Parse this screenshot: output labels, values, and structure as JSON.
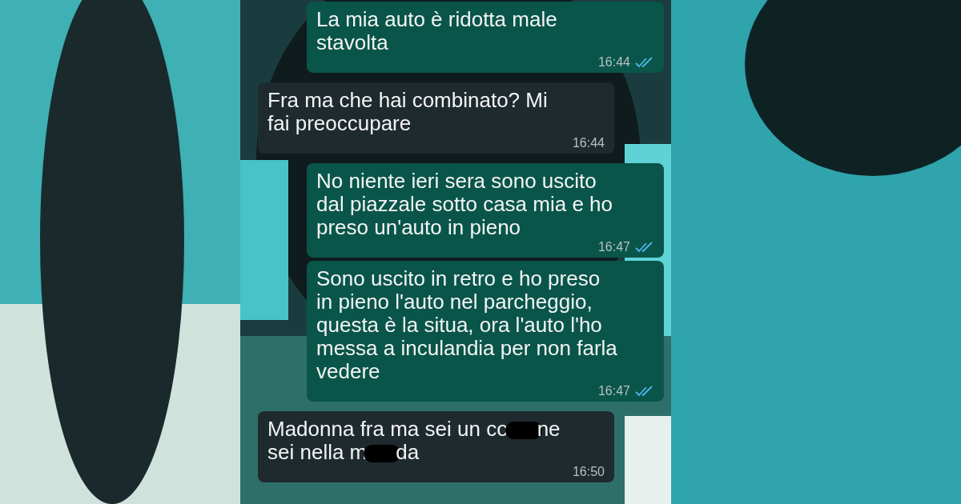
{
  "messages": [
    {
      "kind": "outgoing",
      "lines": [
        [
          {
            "text": "La mia auto è ridotta male"
          }
        ],
        [
          {
            "text": "stavolta"
          }
        ]
      ],
      "time": "16:44",
      "read": true
    },
    {
      "kind": "incoming",
      "lines": [
        [
          {
            "text": "Fra ma che hai combinato? Mi"
          }
        ],
        [
          {
            "text": "fai preoccupare"
          }
        ]
      ],
      "time": "16:44"
    },
    {
      "kind": "outgoing",
      "lines": [
        [
          {
            "text": "No niente ieri sera sono uscito"
          }
        ],
        [
          {
            "text": "dal piazzale sotto casa mia e ho"
          }
        ],
        [
          {
            "text": "preso un'auto in pieno"
          }
        ]
      ],
      "time": "16:47",
      "read": true
    },
    {
      "kind": "outgoing",
      "lines": [
        [
          {
            "text": "Sono uscito in retro e ho preso"
          }
        ],
        [
          {
            "text": "in pieno l'auto nel parcheggio,"
          }
        ],
        [
          {
            "text": "questa è la situa, ora l'auto l'ho"
          }
        ],
        [
          {
            "text": "messa a inculandia per non farla"
          }
        ],
        [
          {
            "text": "vedere"
          }
        ]
      ],
      "time": "16:47",
      "read": true
    },
    {
      "kind": "incoming",
      "lines": [
        [
          {
            "text": "Madonna fra ma sei un co"
          },
          {
            "kind": "censor"
          },
          {
            "text": "ne"
          }
        ],
        [
          {
            "text": "sei nella m"
          },
          {
            "kind": "censor"
          },
          {
            "text": "da"
          }
        ]
      ],
      "time": "16:50"
    }
  ]
}
